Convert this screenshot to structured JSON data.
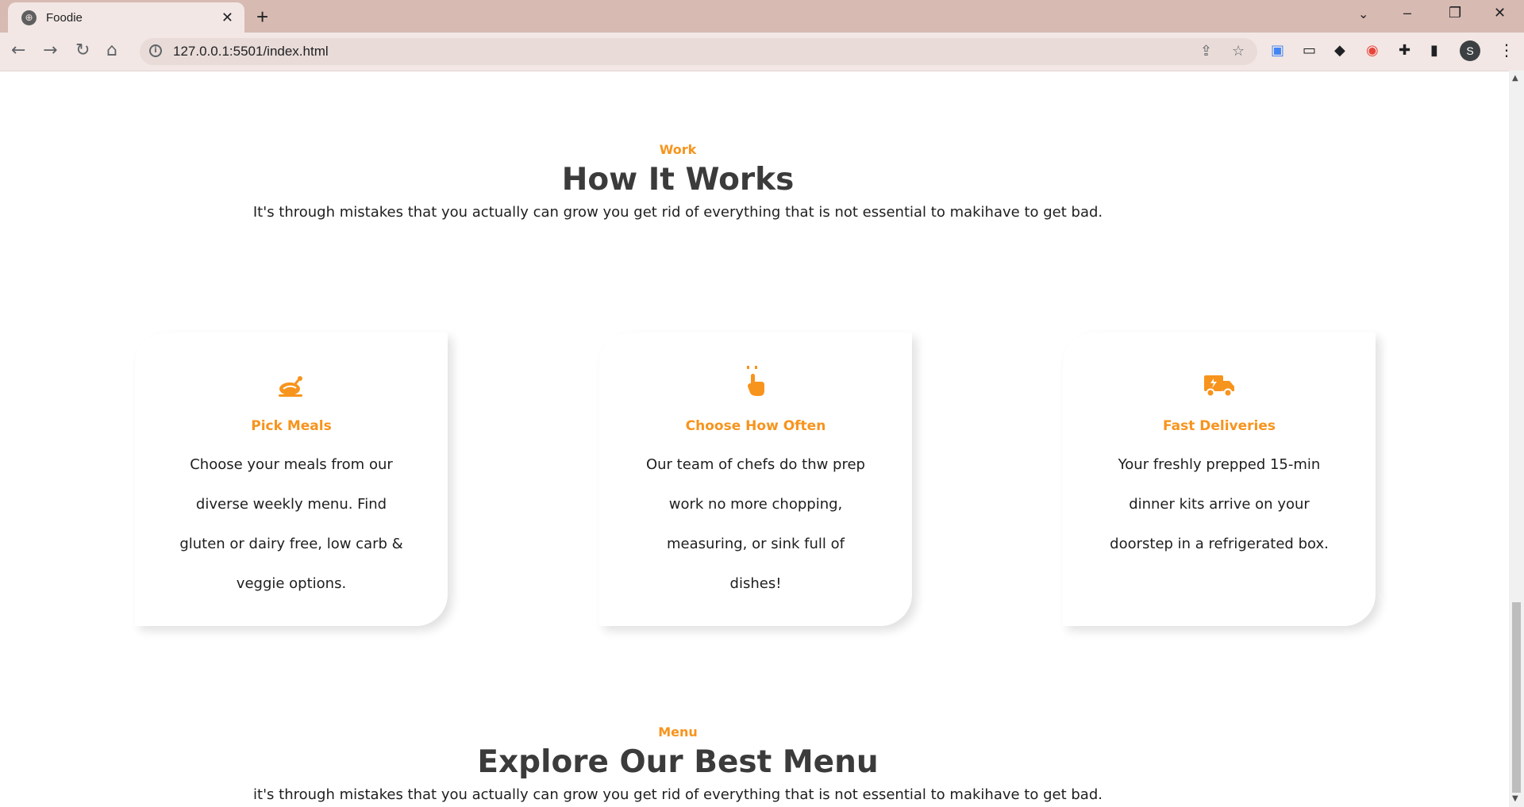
{
  "browser": {
    "tab_title": "Foodie",
    "tab_close": "✕",
    "new_tab": "+",
    "url": "127.0.0.1:5501/index.html",
    "profile_initial": "S",
    "window_controls": {
      "dropdown": "⌄",
      "minimize": "–",
      "restore": "❐",
      "close": "✕"
    }
  },
  "work_section": {
    "eyebrow": "Work",
    "title": "How It Works",
    "subtitle": "It's through mistakes that you actually can grow you get rid of everything that is not essential to makihave to get bad."
  },
  "cards": [
    {
      "icon": "roast-chicken-icon",
      "title": "Pick Meals",
      "text": "Choose your meals from our diverse weekly menu. Find gluten or dairy free, low carb & veggie options."
    },
    {
      "icon": "pointer-hand-icon",
      "title": "Choose How Often",
      "text": "Our team of chefs do thw prep work no more chopping, measuring, or sink full of dishes!"
    },
    {
      "icon": "delivery-truck-icon",
      "title": "Fast Deliveries",
      "text": "Your freshly prepped 15-min dinner kits arrive on your doorstep in a refrigerated box."
    }
  ],
  "menu_section": {
    "eyebrow": "Menu",
    "title": "Explore Our Best Menu",
    "subtitle": "it's through mistakes that you actually can grow you get rid of everything that is not essential to makihave to get bad."
  },
  "colors": {
    "accent": "#f7941d",
    "heading": "#3b3b3b",
    "tab_bar": "#d7bab2",
    "toolbar": "#f2e7e4"
  }
}
